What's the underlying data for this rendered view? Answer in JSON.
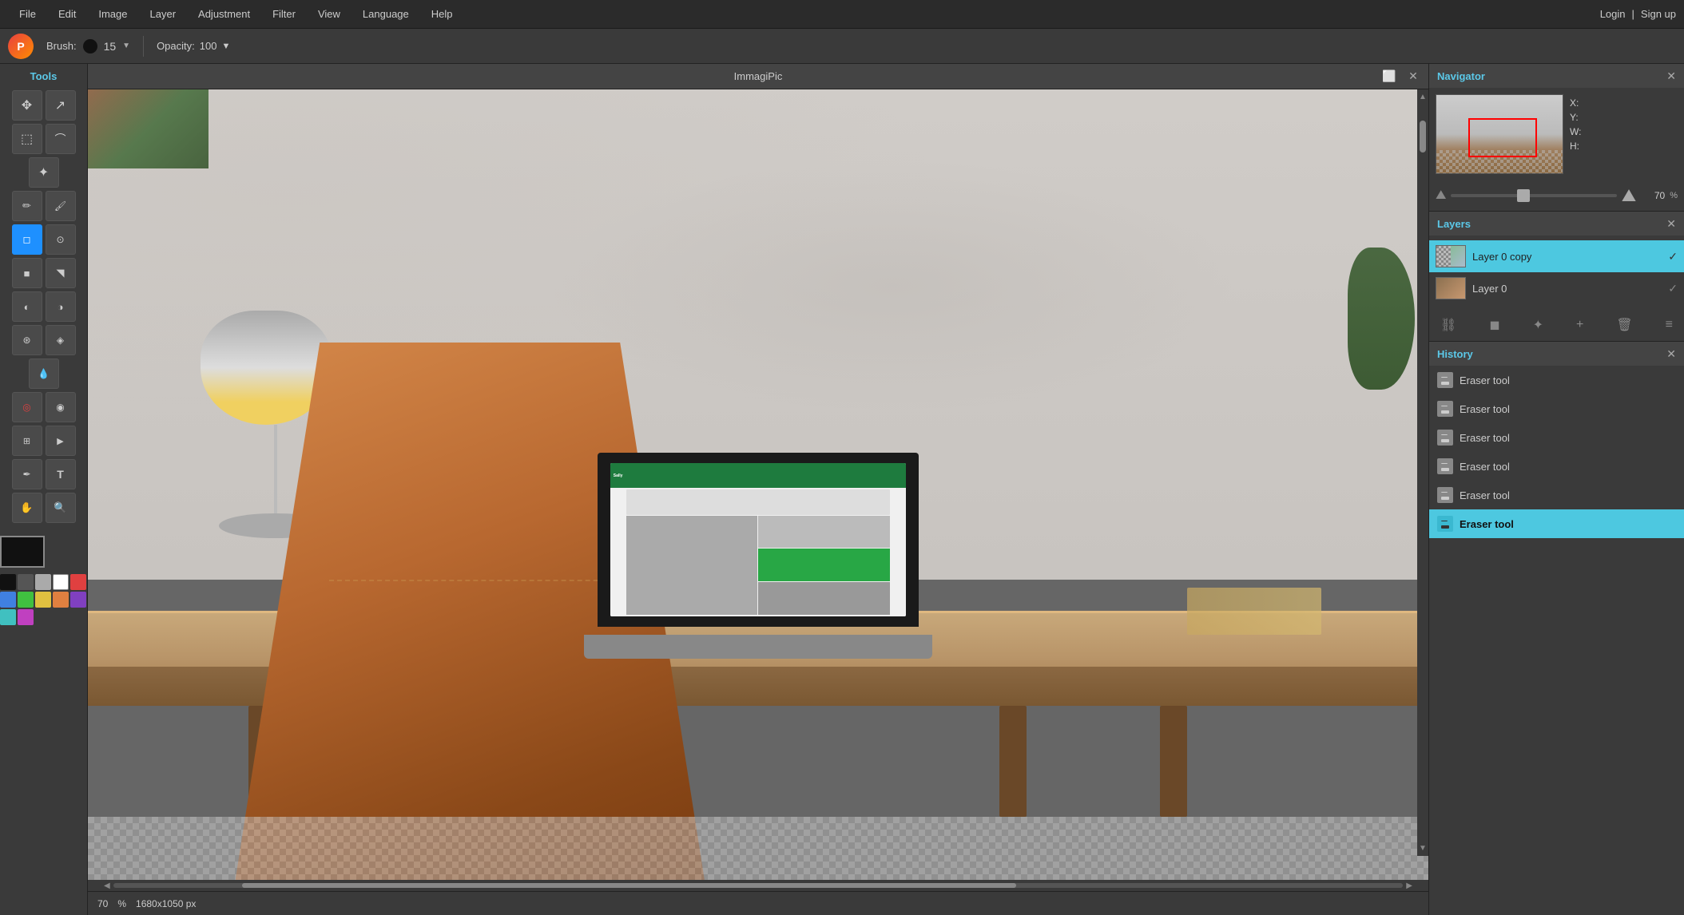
{
  "app": {
    "title": "ImmagiPic"
  },
  "menubar": {
    "items": [
      "File",
      "Edit",
      "Image",
      "Layer",
      "Adjustment",
      "Filter",
      "View",
      "Language",
      "Help"
    ],
    "right": {
      "login": "Login",
      "divider": "|",
      "signup": "Sign up"
    }
  },
  "toolbar": {
    "brush_label": "Brush:",
    "brush_size": "15",
    "opacity_label": "Opacity:",
    "opacity_value": "100"
  },
  "tools_panel": {
    "header": "Tools"
  },
  "canvas": {
    "title": "ImmagiPic",
    "zoom": "70",
    "zoom_pct": "%",
    "dimensions": "1680x1050 px"
  },
  "navigator": {
    "title": "Navigator",
    "x_label": "X:",
    "y_label": "Y:",
    "w_label": "W:",
    "h_label": "H:",
    "zoom_value": "70",
    "zoom_pct": "%"
  },
  "layers": {
    "title": "Layers",
    "items": [
      {
        "name": "Layer 0 copy",
        "active": true,
        "visible": true
      },
      {
        "name": "Layer 0",
        "active": false,
        "visible": true
      }
    ]
  },
  "history": {
    "title": "History",
    "items": [
      {
        "label": "Eraser tool",
        "active": false
      },
      {
        "label": "Eraser tool",
        "active": false
      },
      {
        "label": "Eraser tool",
        "active": false
      },
      {
        "label": "Eraser tool",
        "active": false
      },
      {
        "label": "Eraser tool",
        "active": false
      },
      {
        "label": "Eraser tool",
        "active": true
      }
    ]
  }
}
